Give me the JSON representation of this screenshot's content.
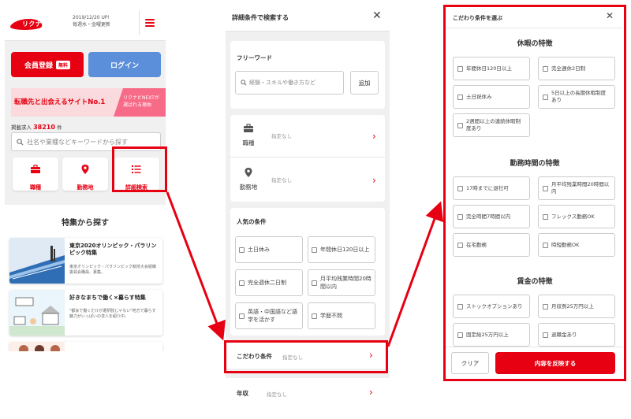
{
  "panel1": {
    "update_line1": "2019/12/20 UP!",
    "update_line2": "毎週水・金曜更新",
    "logo_text": "リクナビNEXT",
    "register_label": "会員登録",
    "register_badge": "無料",
    "login_label": "ログイン",
    "banner_text": "転職先と出会えるサイトNo.1",
    "banner_side_line1": "リクナビNEXTが",
    "banner_side_line2": "選ばれる理由",
    "count_prefix": "掲載求人",
    "count_value": "38210",
    "count_suffix": "件",
    "search_placeholder": "社名や業種などキーワードから探す",
    "quick": [
      {
        "label": "職種",
        "icon": "briefcase-icon"
      },
      {
        "label": "勤務地",
        "icon": "location-pin-icon"
      },
      {
        "label": "詳細検索",
        "icon": "list-icon"
      }
    ],
    "feature_title": "特集から探す",
    "cards": [
      {
        "title": "東京2020オリンピック・パラリンピック特集",
        "desc": "東京オリンピック・パラリンピック競技大会組織委員会職員、募集。"
      },
      {
        "title": "好きなまちで働く×暮らす特集",
        "desc": "\"都会で働くだけが選択肢じゃない\"地方で暮らす魅力がいっぱいの求人を紹介中。"
      }
    ]
  },
  "panel2": {
    "header_title": "詳細条件で検索する",
    "freeword_label": "フリーワード",
    "keyword_placeholder": "経験・スキルや働き方など",
    "add_label": "追加",
    "rows": [
      {
        "label": "職種",
        "value": "指定なし",
        "icon": "briefcase-icon"
      },
      {
        "label": "勤務地",
        "value": "指定なし",
        "icon": "location-pin-icon"
      }
    ],
    "popular_label": "人気の条件",
    "checkboxes": [
      "土日休み",
      "年間休日120日以上",
      "完全週休二日制",
      "月平均残業時間20時間以内",
      "英語・中国語など語学を活かす",
      "学歴不問"
    ],
    "kodawari_label": "こだわり条件",
    "kodawari_value": "指定なし",
    "income_label": "年収",
    "income_value": "指定なし"
  },
  "panel3": {
    "header_title": "こだわり条件を選ぶ",
    "sections": [
      {
        "title": "休暇の特徴",
        "items": [
          "年間休日120日以上",
          "完全週休2日制",
          "土日祝休み",
          "5日以上の長期休暇制度あり",
          "2週間以上の連続休暇制度あり"
        ]
      },
      {
        "title": "勤務時間の特徴",
        "items": [
          "17時までに退社可",
          "月平均残業時間20時間以内",
          "完全時間7時間以内",
          "フレックス勤務OK",
          "在宅勤務",
          "時短勤務OK"
        ]
      },
      {
        "title": "賃金の特徴",
        "items": [
          "ストックオプションあり",
          "月収例25万円以上",
          "固定給25万円以上",
          "退職金あり"
        ]
      }
    ],
    "clear_label": "クリア",
    "apply_label": "内容を反映する"
  },
  "colors": {
    "accent": "#e60012",
    "login_blue": "#5b8fd9",
    "banner_pink": "#fadadd"
  }
}
